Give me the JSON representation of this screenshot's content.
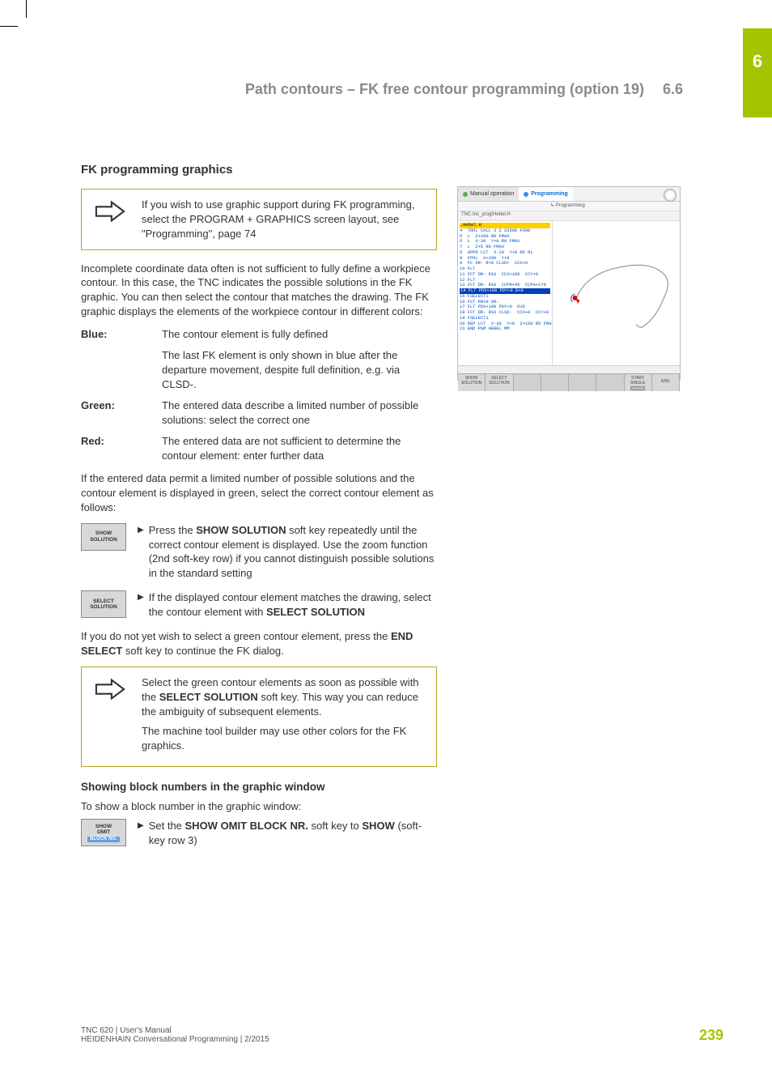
{
  "sidebar": {
    "chapter": "6"
  },
  "header": {
    "title": "Path contours – FK free contour programming (option 19)",
    "section": "6.6"
  },
  "section": {
    "heading": "FK programming graphics",
    "note1": "If you wish to use graphic support during FK programming, select the PROGRAM + GRAPHICS screen layout, see \"Programming\", page 74",
    "intro": "Incomplete coordinate data often is not sufficient to fully define a workpiece contour. In this case, the TNC indicates the possible solutions in the FK graphic. You can then select the contour that matches the drawing. The FK graphic displays the elements of the workpiece contour in different colors:",
    "colors": {
      "blue_label": "Blue:",
      "blue_desc1": "The contour element is fully defined",
      "blue_desc2": "The last FK element is only shown in blue after the departure movement, despite full definition, e.g. via CLSD-.",
      "green_label": "Green:",
      "green_desc": "The entered data describe a limited number of possible solutions: select the correct one",
      "red_label": "Red:",
      "red_desc": "The entered data are not sufficient to determine the contour element: enter further data"
    },
    "para_select": "If the entered data permit a limited number of possible solutions and the contour element is displayed in green, select the correct contour element as follows:",
    "sk1": {
      "btn_l1": "SHOW",
      "btn_l2": "SOLUTION",
      "text_pre": "Press the ",
      "text_bold": "SHOW SOLUTION",
      "text_post": " soft key repeatedly until the correct contour element is displayed. Use the zoom function (2nd soft-key row) if you cannot distinguish possible solutions in the standard setting"
    },
    "sk2": {
      "btn_l1": "SELECT",
      "btn_l2": "SOLUTION",
      "text_pre": "If the displayed contour element matches the drawing, select the contour element with ",
      "text_bold": "SELECT SOLUTION"
    },
    "para_end": "If you do not yet wish to select a green contour element, press the ",
    "para_end_bold": "END SELECT",
    "para_end_post": " soft key to continue the FK dialog.",
    "note2_p1_pre": "Select the green contour elements as soon as possible with the ",
    "note2_p1_bold": "SELECT SOLUTION",
    "note2_p1_post": " soft key. This way you can reduce the ambiguity of subsequent elements.",
    "note2_p2": "The machine tool builder may use other colors for the FK graphics.",
    "sub_heading": "Showing block numbers in the graphic window",
    "sub_intro": "To show a block number in the graphic window:",
    "sk3": {
      "btn_l1": "SHOW",
      "btn_l2": "OMIT",
      "btn_l3": "BLOCK NO.",
      "text_pre": "Set the ",
      "text_bold": "SHOW OMIT BLOCK NR.",
      "text_mid": " soft key to ",
      "text_bold2": "SHOW",
      "text_post": " (soft-key row 3)"
    }
  },
  "screenshot": {
    "tab_inactive": "Manual operation",
    "tab_active": "Programming",
    "tab_sub": "Programming",
    "filename": "TNC:\\nc_prog\\Hebel.H",
    "prog_header": "→Hebel.H",
    "code_lines": [
      "4  TOOL CALL 3 Z S3500 F500",
      "5  L  Z+100 R0 FMAX",
      "6  L  X-30  Y+0 R0 FMAX",
      "7  L  Z+5 R0 FMAX",
      "8  APPR LCT  X-10  Y+0 R5 RL",
      "9  FPOL  X+100  Y+0",
      "9  FC DR- R+0 CLSD+  CCX+0",
      "10 FLT",
      "11 FCT DR- R10  CCX+100  CCY+0",
      "12 FLT",
      "13 FCT DR- R10  CCPR+45  CCPA+170"
    ],
    "hl_line": "14 FLT PDX+100 PDY+0  D+0",
    "code_lines2": [
      "15 FSELECT1",
      "16 FCT PR+0 DR-",
      "17 FLT PDX+100 PDY+0  D16",
      "18 FCT DR- R10 CLSD-  CCX+0  CCY+0",
      "19 FSELECT1",
      "20 DEP LCT  X-30  Y+0  Z+100 R5 FMAX",
      "21 END PGM HEBEL MM"
    ],
    "sk_show_l1": "SHOW",
    "sk_show_l2": "SOLUTION",
    "sk_select_l1": "SELECT",
    "sk_select_l2": "SOLUTION",
    "sk_start_l1": "START",
    "sk_start_l2": "SINGLE",
    "sk_end": "END"
  },
  "footer": {
    "line1": "TNC 620 | User's Manual",
    "line2": "HEIDENHAIN Conversational Programming | 2/2015",
    "page": "239"
  }
}
